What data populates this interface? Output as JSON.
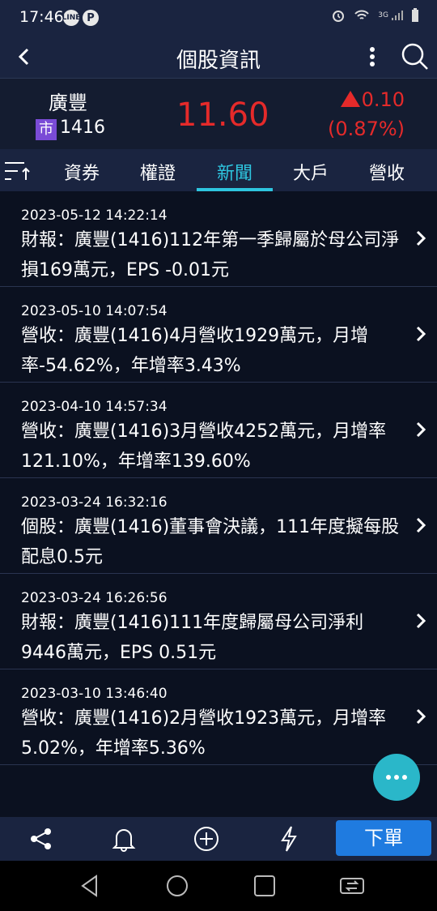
{
  "status_bar": {
    "time": "17:46",
    "icons": [
      "line-icon",
      "parking-icon",
      "alarm-icon",
      "wifi-icon",
      "signal-icon",
      "battery-icon"
    ],
    "network": "3G"
  },
  "app_bar": {
    "title": "個股資訊"
  },
  "quote": {
    "name": "廣豐",
    "market": "市",
    "code": "1416",
    "price": "11.60",
    "change": "0.10",
    "change_pct": "(0.87%)",
    "up_color": "#e52a2a"
  },
  "tabs": [
    {
      "label": "資券"
    },
    {
      "label": "權證"
    },
    {
      "label": "新聞"
    },
    {
      "label": "大戶"
    },
    {
      "label": "營收"
    }
  ],
  "active_tab": "新聞",
  "news": [
    {
      "date": "2023-05-12 14:22:14",
      "title": "財報：廣豐(1416)112年第一季歸屬於母公司淨損169萬元，EPS -0.01元"
    },
    {
      "date": "2023-05-10 14:07:54",
      "title": "營收：廣豐(1416)4月營收1929萬元，月增率-54.62%，年增率3.43%"
    },
    {
      "date": "2023-04-10 14:57:34",
      "title": "營收：廣豐(1416)3月營收4252萬元，月增率121.10%，年增率139.60%"
    },
    {
      "date": "2023-03-24 16:32:16",
      "title": "個股：廣豐(1416)董事會決議，111年度擬每股配息0.5元"
    },
    {
      "date": "2023-03-24 16:26:56",
      "title": "財報：廣豐(1416)111年度歸屬母公司淨利9446萬元，EPS 0.51元"
    },
    {
      "date": "2023-03-10 13:46:40",
      "title": "營收：廣豐(1416)2月營收1923萬元，月增率5.02%，年增率5.36%"
    }
  ],
  "fab": {
    "icon": "more-dots-icon",
    "label": "···"
  },
  "bottom_bar": {
    "icons": [
      "share-icon",
      "bell-icon",
      "add-circle-icon",
      "flash-icon"
    ],
    "order_label": "下單"
  },
  "accent": "#2ec5df"
}
